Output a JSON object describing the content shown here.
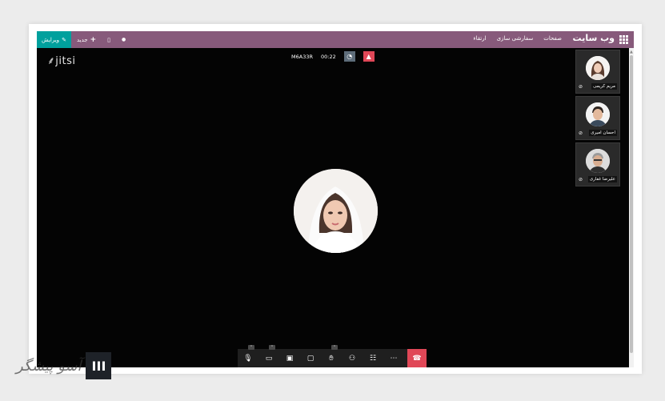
{
  "topbar": {
    "site_title": "وب سایت",
    "menu": [
      "صفحات",
      "سفارشی سازی",
      "ارتقاء"
    ],
    "edit_label": "ویرایش",
    "new_label": "جدید"
  },
  "meeting": {
    "logo": "jitsi",
    "subject": "M6A33R",
    "timer": "00:22",
    "main_participant": "participant-main",
    "participants": [
      {
        "name": "مریم کریمی"
      },
      {
        "name": "احسان امیری"
      },
      {
        "name": "علیرضا غفاری"
      }
    ]
  },
  "toolbar": {
    "items": [
      "mic-muted-icon",
      "camera-off-icon",
      "share-screen-icon",
      "chat-icon",
      "raise-hand-icon",
      "participants-icon",
      "tile-view-icon",
      "more-icon",
      "hangup-icon"
    ]
  },
  "watermark": {
    "text": "آسو پیشگر",
    "logo": "III"
  },
  "colors": {
    "topbar": "#875a7b",
    "edit": "#00a09d",
    "hangup": "#e04757",
    "meeting_bg": "#040404"
  }
}
